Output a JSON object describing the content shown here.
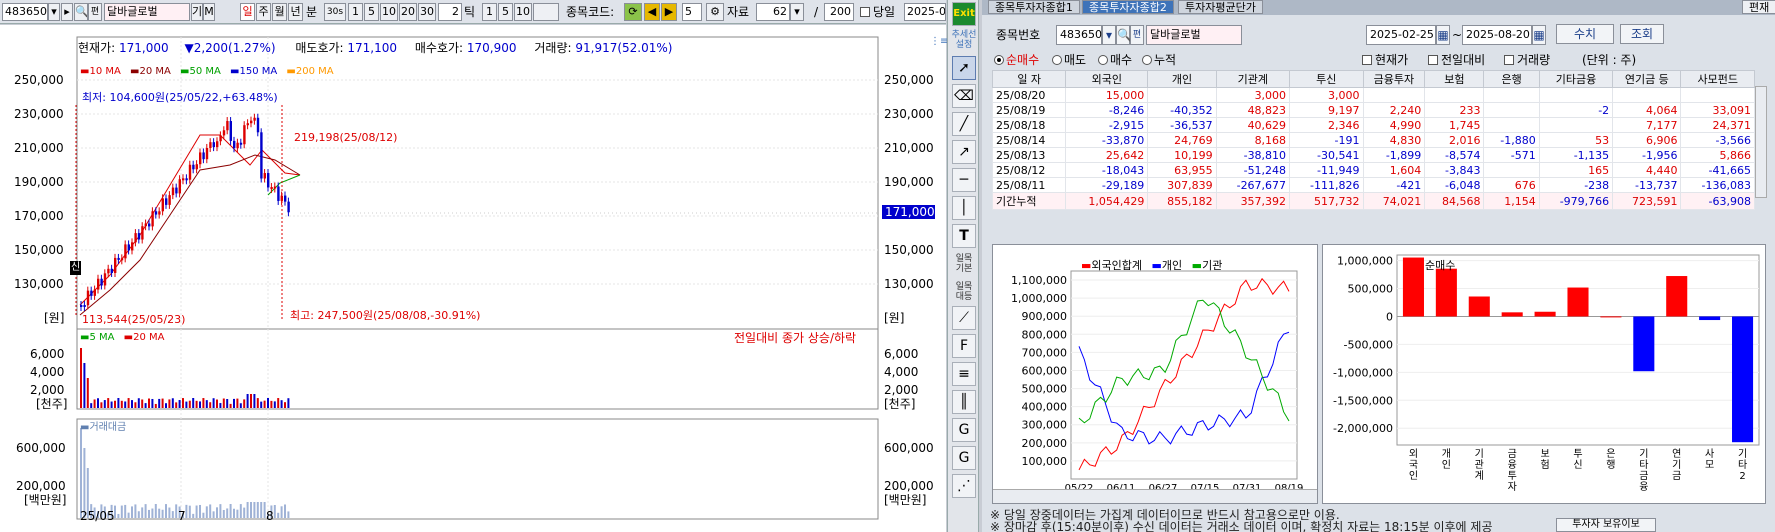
{
  "toolbar": {
    "code": "483650",
    "name": "달바글로벌",
    "gi_label": "기",
    "m_label": "M",
    "periods": [
      "일",
      "주",
      "월",
      "년",
      "분",
      "30s",
      "틱"
    ],
    "minutes": [
      "1",
      "5",
      "10",
      "20",
      "30"
    ],
    "tick_value": "2",
    "tick_opts": [
      "1",
      "5",
      "10"
    ],
    "code_search_label": "종목코드:",
    "step_value": "5",
    "data_label": "자료",
    "data_count": "62",
    "slash": "/",
    "total": "200",
    "today_label": "당일",
    "date_cut": "2025-0"
  },
  "quote": {
    "price_label": "현재가:",
    "price": "171,000",
    "change": "2,200(1.27%)",
    "ask_label": "매도호가:",
    "ask": "171,100",
    "bid_label": "매수호가:",
    "bid": "170,900",
    "volume_label": "거래량:",
    "volume": "91,917(52.01%)"
  },
  "legend_ma": [
    {
      "label": "10 MA",
      "color": "#d00000"
    },
    {
      "label": "20 MA",
      "color": "#8b0000"
    },
    {
      "label": "50 MA",
      "color": "#00a000"
    },
    {
      "label": "150 MA",
      "color": "#0000cc"
    },
    {
      "label": "200 MA",
      "color": "#ff9900"
    }
  ],
  "price_axis": [
    "250,000",
    "230,000",
    "210,000",
    "190,000",
    "170,000",
    "150,000",
    "130,000"
  ],
  "price_unit": "[원]",
  "current_price_tag": "171,000",
  "annotations": {
    "low_label": "최저: 104,600원(25/05/22,+63.48%)",
    "mid_label": "219,198(25/08/12)",
    "min_label": "113,544(25/05/23)",
    "max_label": "최고: 247,500원(25/08/08,-30.91%)",
    "sin_badge": "신"
  },
  "vol_legend": [
    {
      "label": "5 MA",
      "color": "#00a000"
    },
    {
      "label": "20 MA",
      "color": "#d00000"
    }
  ],
  "vol_note": "전일대비 종가 상승/하락",
  "vol_axis": [
    "6,000",
    "4,000",
    "2,000"
  ],
  "vol_unit": "[천주]",
  "amt_legend": "거래대금",
  "amt_axis": [
    "600,000",
    "200,000"
  ],
  "amt_unit": "[백만원]",
  "x_labels": [
    "25/05",
    "7",
    "8"
  ],
  "vtoolbar": {
    "exit": "Exit",
    "setting": "추세선\n설정",
    "t1": "일목\n기본",
    "t2": "일목\n대등"
  },
  "right": {
    "tabs": [
      "종목투자자종합1",
      "종목투자자종합2",
      "투자자평균단가"
    ],
    "top_right_btn": "편재",
    "code_label": "종목번호",
    "code": "483650",
    "name": "달바글로벌",
    "date_from": "2025-02-25",
    "date_to": "2025-08-20",
    "btn_value": "수치",
    "btn_query": "조회",
    "radios": [
      {
        "label": "순매수",
        "on": true
      },
      {
        "label": "매도",
        "on": false
      },
      {
        "label": "매수",
        "on": false
      },
      {
        "label": "누적",
        "on": false
      }
    ],
    "checks": [
      "현재가",
      "전일대비",
      "거래량"
    ],
    "unit": "(단위 : 주)",
    "table_headers": [
      "일 자",
      "외국인",
      "개인",
      "기관계",
      "투신",
      "금융투자",
      "보험",
      "은행",
      "기타금융",
      "연기금 등",
      "사모펀드"
    ],
    "table_rows": [
      [
        "25/08/20",
        "15,000",
        "",
        "3,000",
        "3,000",
        "",
        "",
        "",
        "",
        "",
        ""
      ],
      [
        "25/08/19",
        "-8,246",
        "-40,352",
        "48,823",
        "9,197",
        "2,240",
        "233",
        "",
        "-2",
        "4,064",
        "33,091"
      ],
      [
        "25/08/18",
        "-2,915",
        "-36,537",
        "40,629",
        "2,346",
        "4,990",
        "1,745",
        "",
        "",
        "7,177",
        "24,371"
      ],
      [
        "25/08/14",
        "-33,870",
        "24,769",
        "8,168",
        "-191",
        "4,830",
        "2,016",
        "-1,880",
        "53",
        "6,906",
        "-3,566"
      ],
      [
        "25/08/13",
        "25,642",
        "10,199",
        "-38,810",
        "-30,541",
        "-1,899",
        "-8,574",
        "-571",
        "-1,135",
        "-1,956",
        "5,866"
      ],
      [
        "25/08/12",
        "-18,043",
        "63,955",
        "-51,248",
        "-11,949",
        "1,604",
        "-3,843",
        "",
        "165",
        "4,440",
        "-41,665"
      ],
      [
        "25/08/11",
        "-29,189",
        "307,839",
        "-267,677",
        "-111,826",
        "-421",
        "-6,048",
        "676",
        "-238",
        "-13,737",
        "-136,083"
      ],
      [
        "기간누적",
        "1,054,429",
        "855,182",
        "357,392",
        "517,732",
        "74,021",
        "84,568",
        "1,154",
        "-979,766",
        "723,591",
        "-63,908"
      ]
    ],
    "line_legend": [
      {
        "label": "외국인합계",
        "color": "#ff0000"
      },
      {
        "label": "개인",
        "color": "#0000ff"
      },
      {
        "label": "기관",
        "color": "#00aa00"
      }
    ],
    "line_y_axis": [
      "1,100,000",
      "1,000,000",
      "900,000",
      "800,000",
      "700,000",
      "600,000",
      "500,000",
      "400,000",
      "300,000",
      "200,000",
      "100,000"
    ],
    "line_x_axis": [
      "05/22",
      "06/11",
      "06/27",
      "07/15",
      "07/31",
      "08/19"
    ],
    "bar_title": "순매수",
    "bar_y_axis": [
      "1,000,000",
      "500,000",
      "0",
      "-500,000",
      "-1,000,000",
      "-1,500,000",
      "-2,000,000"
    ],
    "notes": [
      "※ 당일 장중데이터는 가집계 데이터이므로 반드시 참고용으로만 이용.",
      "※ 장마감 후(15:40분이후) 수신 데이터는 거래소 데이터 이며, 확정치 자료는 18:15분 이후에 제공"
    ],
    "note_btn": "투자자 보유이보"
  },
  "chart_data": [
    {
      "type": "line",
      "title": "",
      "x": [
        "05/22",
        "06/11",
        "06/27",
        "07/15",
        "07/31",
        "08/19"
      ],
      "series": [
        {
          "name": "외국인합계",
          "values": [
            50000,
            200000,
            500000,
            800000,
            1080000,
            1050000
          ]
        },
        {
          "name": "개인",
          "values": [
            700000,
            250000,
            220000,
            300000,
            350000,
            850000
          ]
        },
        {
          "name": "기관",
          "values": [
            300000,
            550000,
            600000,
            1020000,
            700000,
            350000
          ]
        }
      ],
      "ylim": [
        0,
        1150000
      ]
    },
    {
      "type": "bar",
      "title": "순매수",
      "categories": [
        "외국인",
        "개인",
        "기관계",
        "금융투자",
        "보험",
        "투신",
        "은행",
        "기타금융",
        "연기금",
        "사모",
        "기타2"
      ],
      "values": [
        1054429,
        855182,
        357392,
        74021,
        84568,
        517732,
        1154,
        -979766,
        723591,
        -63908,
        -2250000
      ],
      "ylim": [
        -2300000,
        1100000
      ]
    }
  ]
}
